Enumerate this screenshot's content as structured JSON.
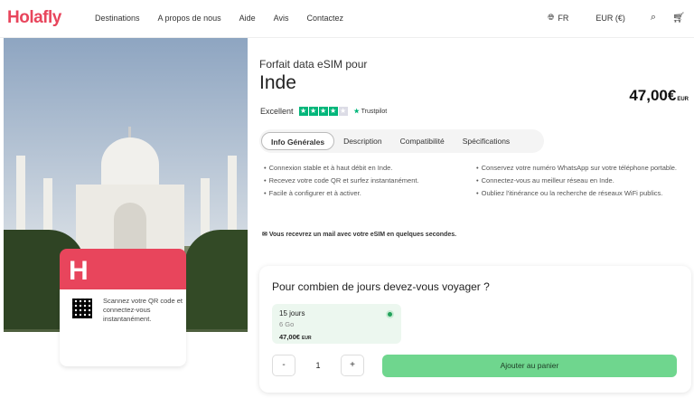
{
  "header": {
    "logo": "Holafly",
    "nav": [
      "Destinations",
      "A propos de nous",
      "Aide",
      "Avis",
      "Contactez"
    ],
    "language": "FR",
    "currency": "EUR (€)",
    "icons": [
      "globe-icon",
      "search-icon",
      "cart-icon"
    ]
  },
  "hero": {
    "card_logo": "H",
    "qr_text": "Scannez votre QR code et connectez-vous instantanément."
  },
  "product": {
    "subtitle": "Forfait data eSIM pour",
    "title": "Inde",
    "price": "47,00€",
    "price_currency": "EUR",
    "rating_label": "Excellent",
    "trustpilot": "Trustpilot"
  },
  "tabs": [
    "Info Générales",
    "Description",
    "Compatibilité",
    "Spécifications"
  ],
  "features_left": [
    "Connexion stable et à haut débit en Inde.",
    "Recevez votre code QR et surfez instantanément.",
    "Facile à configurer et à activer."
  ],
  "features_right": [
    "Conservez votre numéro WhatsApp sur votre téléphone portable.",
    "Connectez-vous au meilleur réseau en Inde.",
    "Oubliez l'itinérance ou la recherche de réseaux WiFi publics."
  ],
  "mail_note": "Vous recevrez un mail avec votre eSIM en quelques secondes.",
  "purchase": {
    "question": "Pour combien de jours devez-vous voyager ?",
    "option_days": "15 jours",
    "option_data": "6 Go",
    "option_price": "47,00€",
    "option_currency": "EUR",
    "qty_minus": "-",
    "qty_value": "1",
    "qty_plus": "+",
    "add_to_cart": "Ajouter au panier"
  }
}
